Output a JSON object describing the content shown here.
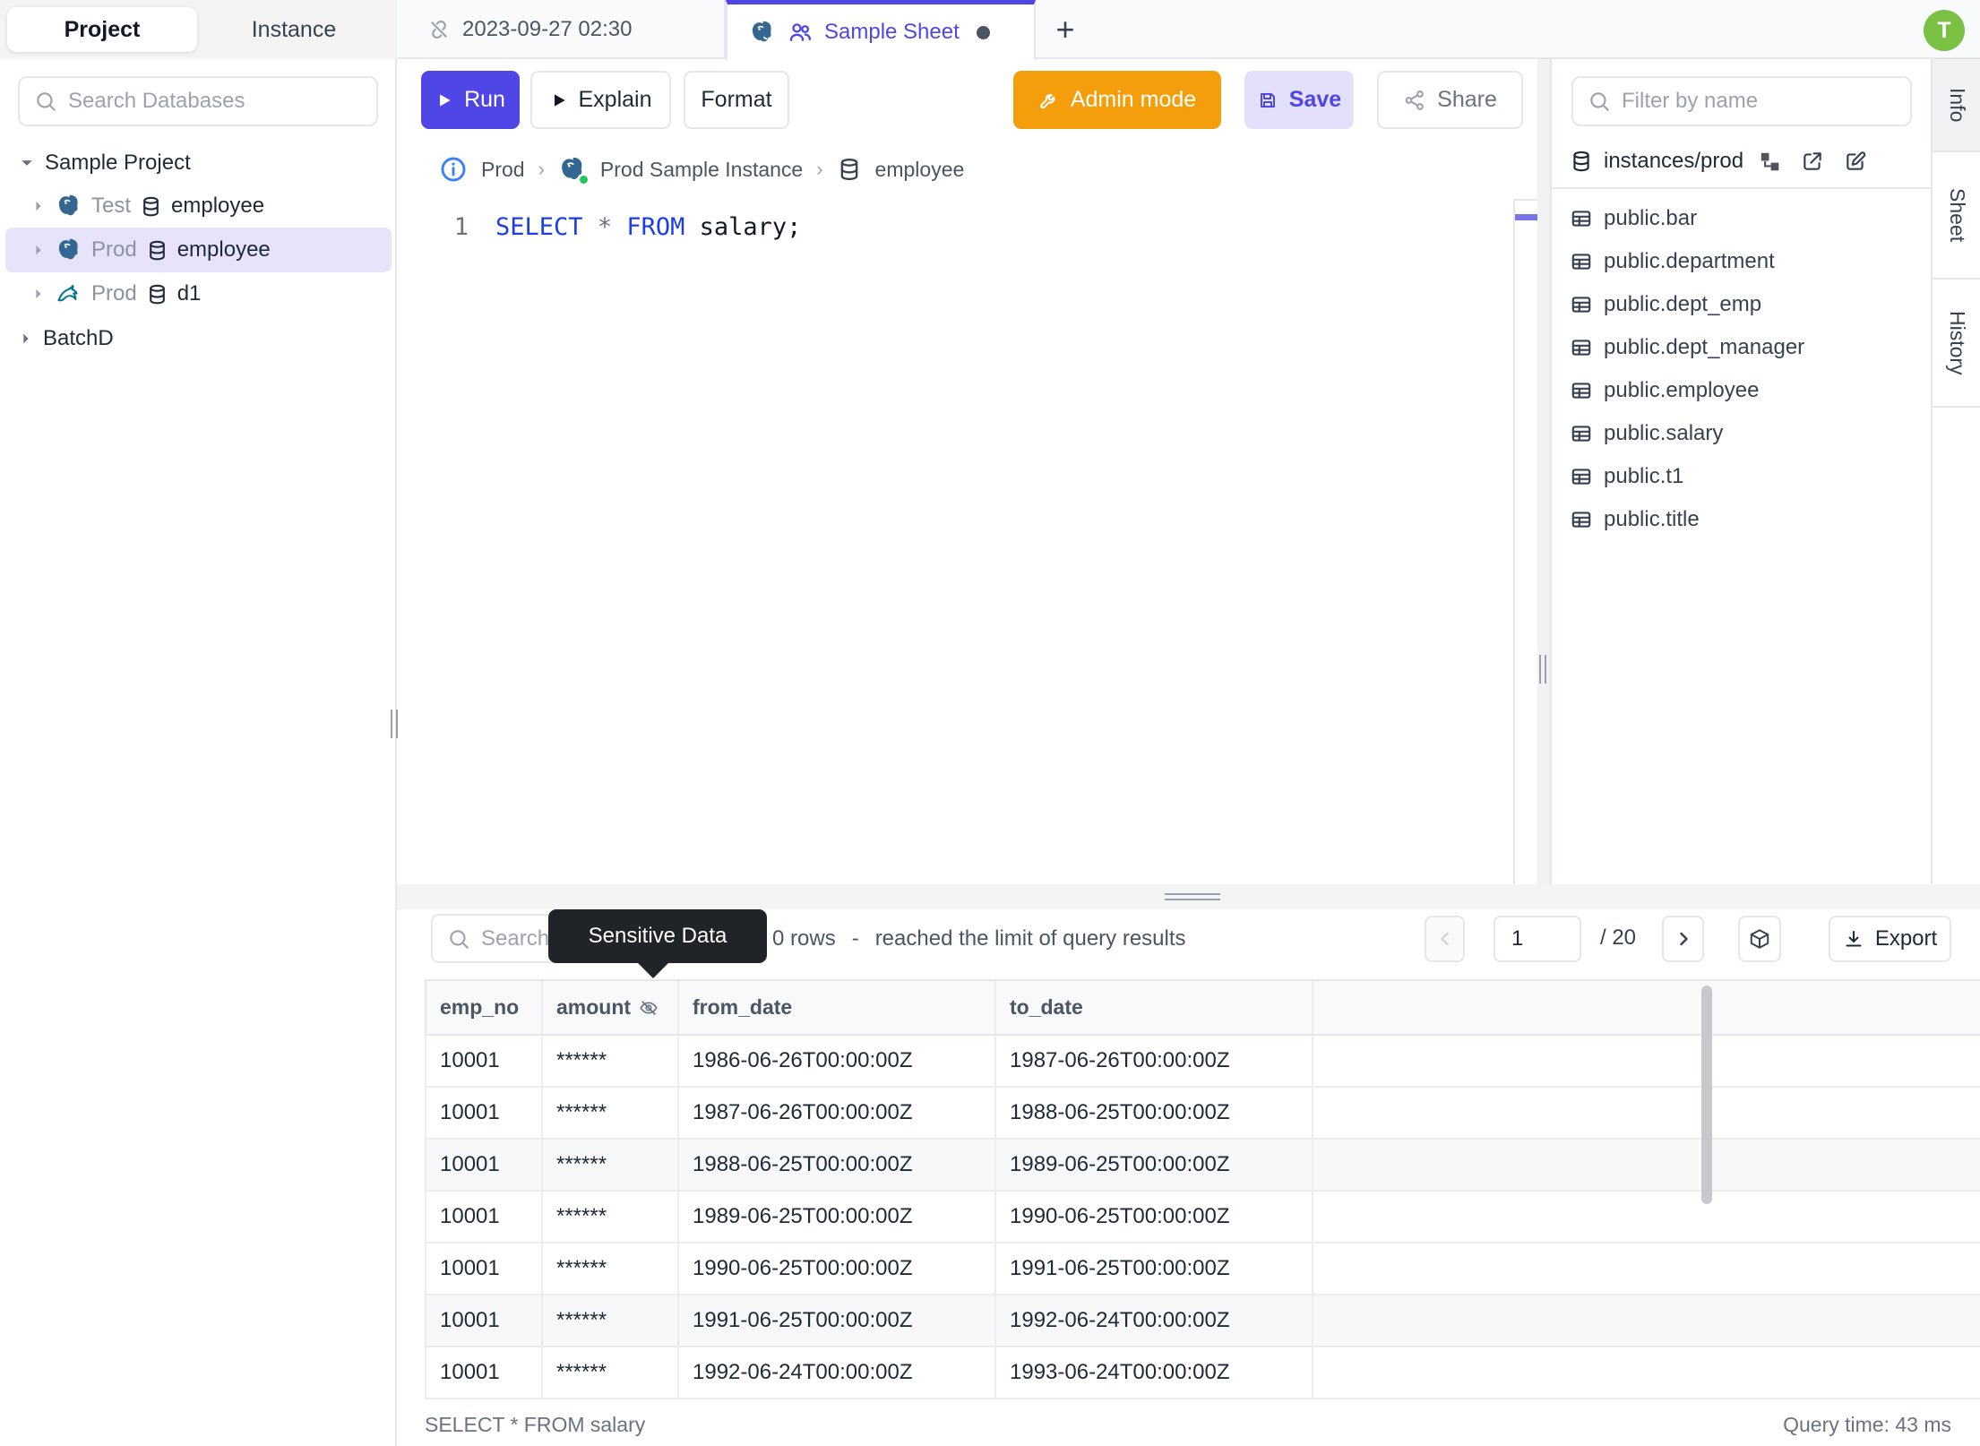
{
  "window": {
    "avatar_initial": "T"
  },
  "nav": {
    "project_tab": "Project",
    "instance_tab": "Instance"
  },
  "tabs": {
    "tab1": "2023-09-27 02:30",
    "tab2": "Sample Sheet",
    "new_tab": "+"
  },
  "sidebar": {
    "search_placeholder": "Search Databases",
    "project": "Sample Project",
    "items": [
      {
        "env": "Test",
        "name": "employee",
        "engine": "postgres"
      },
      {
        "env": "Prod",
        "name": "employee",
        "engine": "postgres"
      },
      {
        "env": "Prod",
        "name": "d1",
        "engine": "mysql"
      }
    ],
    "batch": "BatchD"
  },
  "toolbar": {
    "run": "Run",
    "explain": "Explain",
    "format": "Format",
    "admin_mode": "Admin mode",
    "save": "Save",
    "share": "Share"
  },
  "breadcrumb": {
    "environment": "Prod",
    "instance": "Prod Sample Instance",
    "database": "employee"
  },
  "editor": {
    "line_number": "1",
    "select_kw": "SELECT",
    "star": "*",
    "from_kw": "FROM",
    "identifier": "salary;"
  },
  "schema_panel": {
    "filter_placeholder": "Filter by name",
    "title": "instances/prod",
    "tables": [
      "public.bar",
      "public.department",
      "public.dept_emp",
      "public.dept_manager",
      "public.employee",
      "public.salary",
      "public.t1",
      "public.title"
    ]
  },
  "side_tabs": {
    "info": "Info",
    "sheet": "Sheet",
    "history": "History"
  },
  "results": {
    "search_placeholder": "Search",
    "tooltip": "Sensitive Data",
    "row_count": "0 rows",
    "dash": "-",
    "limit_message": "reached the limit of query results",
    "page_current": "1",
    "page_total": "/ 20",
    "export_label": "Export",
    "columns": [
      "emp_no",
      "amount",
      "from_date",
      "to_date"
    ],
    "rows": [
      [
        "10001",
        "******",
        "1986-06-26T00:00:00Z",
        "1987-06-26T00:00:00Z"
      ],
      [
        "10001",
        "******",
        "1987-06-26T00:00:00Z",
        "1988-06-25T00:00:00Z"
      ],
      [
        "10001",
        "******",
        "1988-06-25T00:00:00Z",
        "1989-06-25T00:00:00Z"
      ],
      [
        "10001",
        "******",
        "1989-06-25T00:00:00Z",
        "1990-06-25T00:00:00Z"
      ],
      [
        "10001",
        "******",
        "1990-06-25T00:00:00Z",
        "1991-06-25T00:00:00Z"
      ],
      [
        "10001",
        "******",
        "1991-06-25T00:00:00Z",
        "1992-06-24T00:00:00Z"
      ],
      [
        "10001",
        "******",
        "1992-06-24T00:00:00Z",
        "1993-06-24T00:00:00Z"
      ]
    ],
    "status_query": "SELECT * FROM salary",
    "query_time": "Query time: 43 ms"
  },
  "colors": {
    "accent": "#4f46e5",
    "admin_orange": "#f59e0b",
    "avatar_green": "#7ac143",
    "keyword_blue": "#1a3ee8",
    "postgres_blue": "#336791",
    "mysql_teal": "#00758f",
    "ok_green": "#22c55e",
    "selected_row": "#e6e3fa"
  }
}
